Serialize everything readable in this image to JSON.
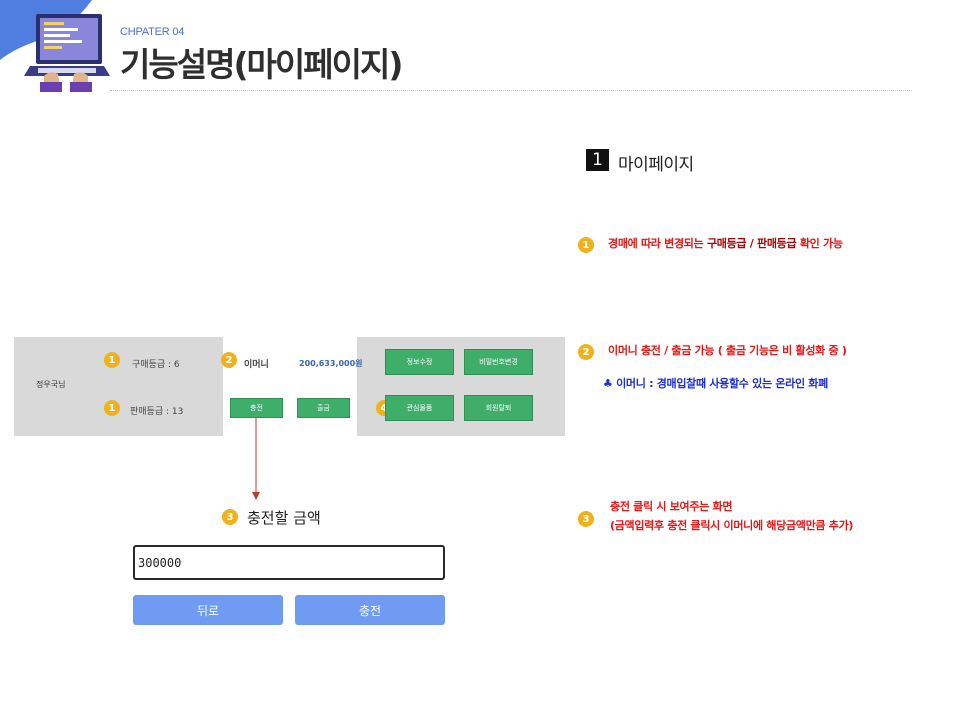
{
  "header": {
    "chapter": "CHPATER 04",
    "title": "기능설명(마이페이지)"
  },
  "mypage_ui": {
    "user_name": "정우국님",
    "purchase_grade": "구매등급 : 6",
    "sale_grade": "판매등급 : 13",
    "emoney_label": "이머니",
    "emoney_value": "200,633,000원",
    "charge_button": "충전",
    "withdraw_button": "출금",
    "edit_info_button": "정보수정",
    "change_password_button": "비밀번호변경",
    "wishlist_button": "관심물품",
    "withdraw_member_button": "회원탈퇴",
    "badges": [
      "1",
      "1",
      "2",
      "4",
      "3"
    ]
  },
  "charge_form": {
    "title": "충전할 금액",
    "amount_value": "300000",
    "back_button": "뒤로",
    "submit_button": "충전"
  },
  "section": {
    "number": "1",
    "title": "마이페이지"
  },
  "notes": {
    "note1_prefix": "경매에 따라 변경되는 ",
    "note1_emph": "구매등급 / 판매등급",
    "note1_suffix": " 확인 가능",
    "note2": "이머니 충전 / 출금 가능 ( 출금 기능은 비 활성화 중 )",
    "note2_sub": "♣ 이머니 : 경매입찰때 사용할수 있는 온라인 화폐",
    "note3_line1": "충전 클릭 시 보여주는 화면",
    "note3_line2": "(금액입력후 충전 클릭시 이머니에 해당금액만큼 추가)"
  },
  "colors": {
    "accent_orange": "#f0b21c",
    "note_red": "#e41616",
    "note_blue": "#1d2fd8",
    "button_green": "#3fae6b",
    "button_blue": "#6f9cf2"
  }
}
